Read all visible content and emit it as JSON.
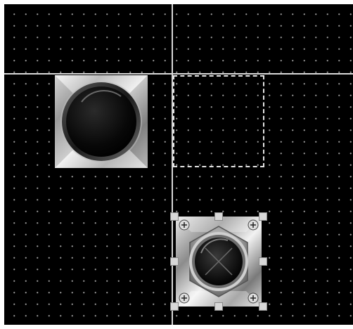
{
  "canvas": {
    "background_color": "#000000",
    "grid_dot_color": "#9a9a9a",
    "grid_visible": true
  },
  "guides": {
    "color": "#d8d8d8"
  },
  "selection": {
    "style": "dashed",
    "color": "#e4e4e4"
  },
  "widgets": [
    {
      "icon": "push-button-dark-icon",
      "state": "unselected"
    },
    {
      "icon": "push-button-metal-icon",
      "state": "selected"
    }
  ]
}
